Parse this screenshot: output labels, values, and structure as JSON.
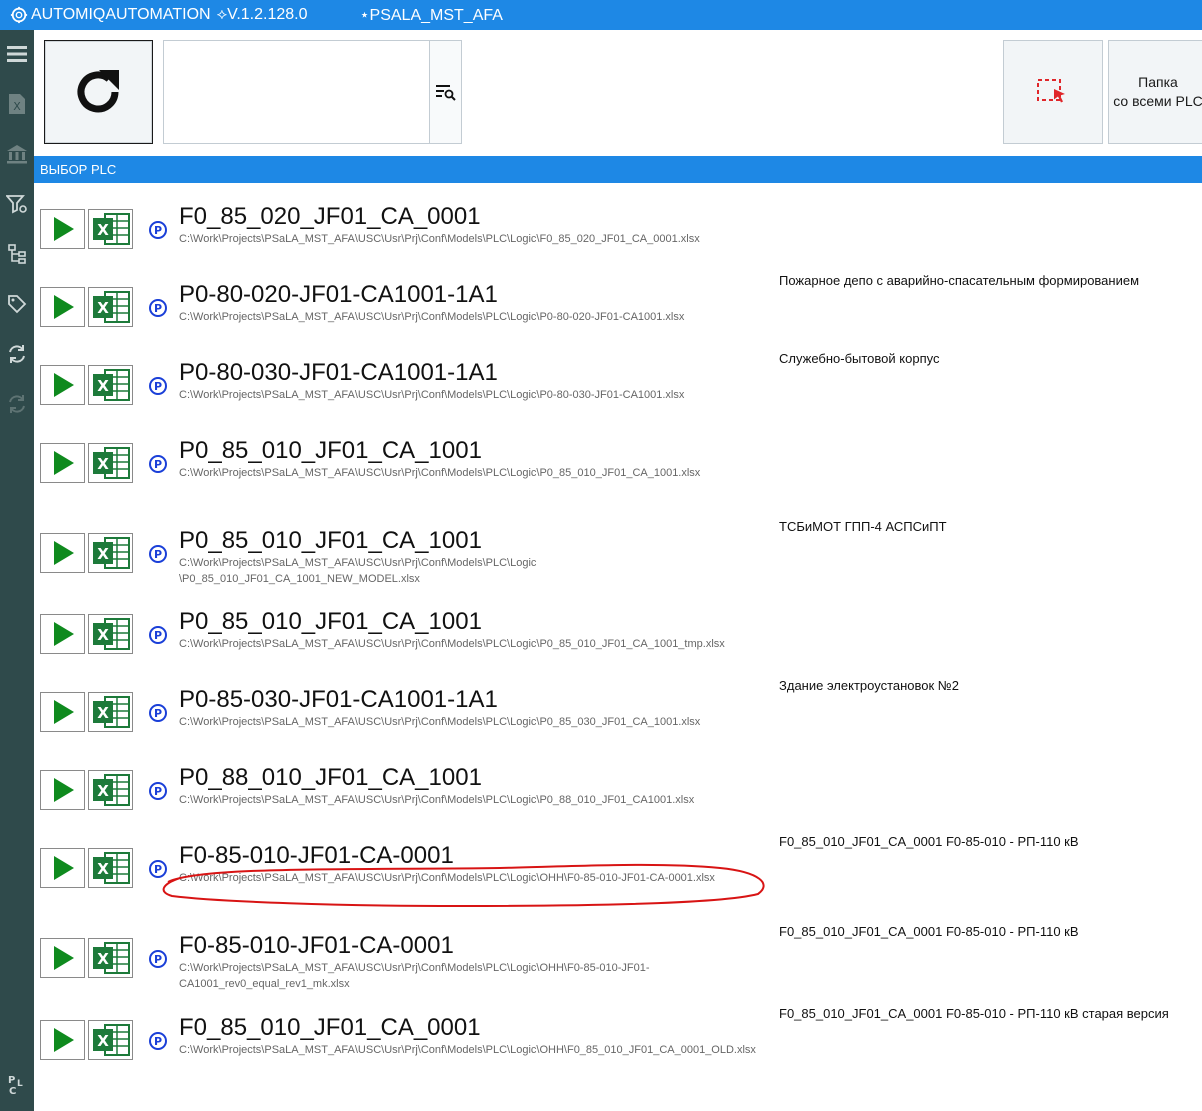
{
  "titlebar": {
    "app_name": "AUTOMIQAUTOMATION",
    "version": "⟡V.1.2.128.0",
    "project": "⋆PSALA_MST_AFA"
  },
  "sidebar": {
    "items": [
      {
        "icon": "hamburger-menu-icon"
      },
      {
        "icon": "excel-file-icon"
      },
      {
        "icon": "bank-building-icon"
      },
      {
        "icon": "filter-settings-icon"
      },
      {
        "icon": "tree-structure-icon"
      },
      {
        "icon": "tag-icon"
      },
      {
        "icon": "sync-icon"
      },
      {
        "icon": "sync-disabled-icon"
      },
      {
        "icon": "plc-icon"
      }
    ]
  },
  "toolbar": {
    "search_value": "",
    "search_placeholder": "",
    "folder_button_line1": "Папка",
    "folder_button_line2": "со всеми PLC"
  },
  "section": {
    "title": "ВЫБОР PLC"
  },
  "rows": [
    {
      "name": "F0_85_020_JF01_CA_0001",
      "path": "C:\\Work\\Projects\\PSaLA_MST_AFA\\USC\\Usr\\Prj\\Conf\\Models\\PLC\\Logic\\F0_85_020_JF01_CA_0001.xlsx",
      "desc": ""
    },
    {
      "name": "P0-80-020-JF01-CA1001-1A1",
      "path": "C:\\Work\\Projects\\PSaLA_MST_AFA\\USC\\Usr\\Prj\\Conf\\Models\\PLC\\Logic\\P0-80-020-JF01-CA1001.xlsx",
      "desc": "Пожарное депо с аварийно-спасательным формированием"
    },
    {
      "name": "P0-80-030-JF01-CA1001-1A1",
      "path": "C:\\Work\\Projects\\PSaLA_MST_AFA\\USC\\Usr\\Prj\\Conf\\Models\\PLC\\Logic\\P0-80-030-JF01-CA1001.xlsx",
      "desc": "Служебно-бытовой корпус"
    },
    {
      "name": "P0_85_010_JF01_CA_1001",
      "path": "C:\\Work\\Projects\\PSaLA_MST_AFA\\USC\\Usr\\Prj\\Conf\\Models\\PLC\\Logic\\P0_85_010_JF01_CA_1001.xlsx",
      "desc": ""
    },
    {
      "name": "P0_85_010_JF01_CA_1001",
      "path": "C:\\Work\\Projects\\PSaLA_MST_AFA\\USC\\Usr\\Prj\\Conf\\Models\\PLC\\Logic\n\\P0_85_010_JF01_CA_1001_NEW_MODEL.xlsx",
      "desc": "ТСБиМОТ ГПП-4 АСПСиПТ"
    },
    {
      "name": "P0_85_010_JF01_CA_1001",
      "path": "C:\\Work\\Projects\\PSaLA_MST_AFA\\USC\\Usr\\Prj\\Conf\\Models\\PLC\\Logic\\P0_85_010_JF01_CA_1001_tmp.xlsx",
      "desc": ""
    },
    {
      "name": "P0-85-030-JF01-CA1001-1A1",
      "path": "C:\\Work\\Projects\\PSaLA_MST_AFA\\USC\\Usr\\Prj\\Conf\\Models\\PLC\\Logic\\P0_85_030_JF01_CA_1001.xlsx",
      "desc": "Здание электроустановок №2"
    },
    {
      "name": "P0_88_010_JF01_CA_1001",
      "path": "C:\\Work\\Projects\\PSaLA_MST_AFA\\USC\\Usr\\Prj\\Conf\\Models\\PLC\\Logic\\P0_88_010_JF01_CA1001.xlsx",
      "desc": ""
    },
    {
      "name": "F0-85-010-JF01-CA-0001",
      "path": "C:\\Work\\Projects\\PSaLA_MST_AFA\\USC\\Usr\\Prj\\Conf\\Models\\PLC\\Logic\\OHH\\F0-85-010-JF01-CA-0001.xlsx",
      "desc": "F0_85_010_JF01_CA_0001 F0-85-010 - РП-110 кВ"
    },
    {
      "name": "F0-85-010-JF01-CA-0001",
      "path": "C:\\Work\\Projects\\PSaLA_MST_AFA\\USC\\Usr\\Prj\\Conf\\Models\\PLC\\Logic\\OHH\\F0-85-010-JF01-\nCA1001_rev0_equal_rev1_mk.xlsx",
      "desc": "F0_85_010_JF01_CA_0001 F0-85-010 - РП-110 кВ"
    },
    {
      "name": "F0_85_010_JF01_CA_0001",
      "path": "C:\\Work\\Projects\\PSaLA_MST_AFA\\USC\\Usr\\Prj\\Conf\\Models\\PLC\\Logic\\OHH\\F0_85_010_JF01_CA_0001_OLD.xlsx",
      "desc": "F0_85_010_JF01_CA_0001 F0-85-010 - РП-110 кВ старая версия"
    }
  ],
  "colors": {
    "accent": "#1e88e5",
    "sidebar": "#2f4a4b",
    "play_green": "#0f8a1e",
    "excel_green": "#1d7a3a",
    "annotation_red": "#d81414"
  }
}
